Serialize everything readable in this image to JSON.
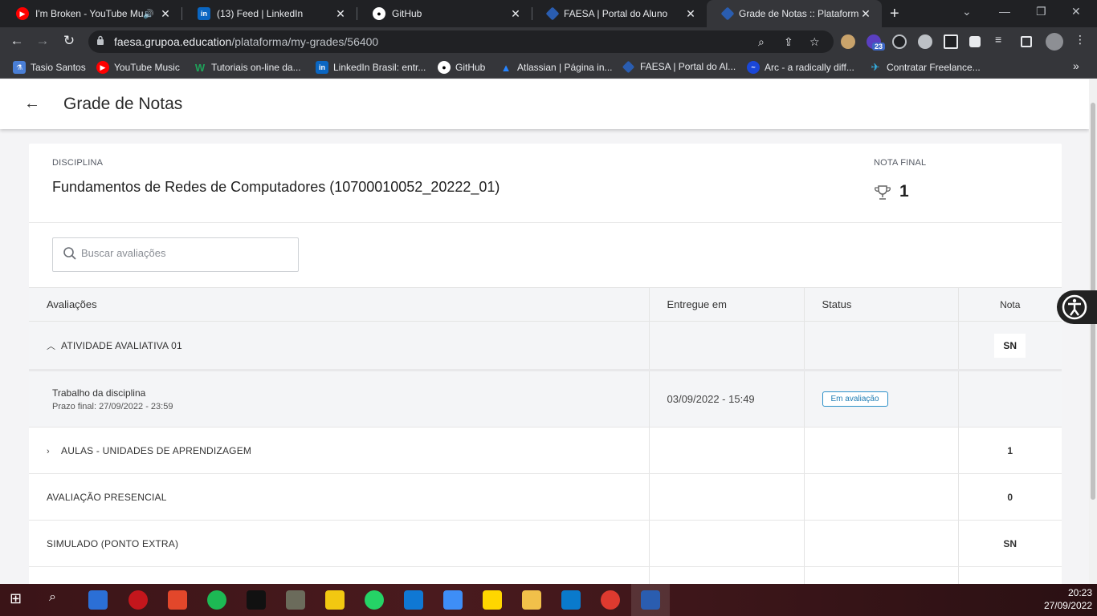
{
  "browser": {
    "tabs": [
      {
        "title": "I'm Broken - YouTube Mu",
        "favicon": "youtube-music",
        "color": "#ff0000",
        "audio": true
      },
      {
        "title": "(13) Feed | LinkedIn",
        "favicon": "linkedin",
        "color": "#0a66c2"
      },
      {
        "title": "GitHub",
        "favicon": "github",
        "color": "#ffffff"
      },
      {
        "title": "FAESA | Portal do Aluno",
        "favicon": "faesa",
        "color": "#2a5db0"
      },
      {
        "title": "Grade de Notas :: Plataforma",
        "favicon": "faesa",
        "color": "#2a5db0",
        "active": true
      }
    ],
    "url_host": "faesa.grupoa.education",
    "url_path": "/plataforma/my-grades/56400",
    "extension_badge": "23",
    "bookmarks": [
      {
        "label": "Tasio Santos",
        "icon": "flask"
      },
      {
        "label": "YouTube Music",
        "icon": "youtube-music"
      },
      {
        "label": "Tutoriais on-line da...",
        "icon": "w"
      },
      {
        "label": "LinkedIn Brasil: entr...",
        "icon": "linkedin"
      },
      {
        "label": "GitHub",
        "icon": "github"
      },
      {
        "label": "Atlassian | Página in...",
        "icon": "atlassian"
      },
      {
        "label": "FAESA | Portal do Al...",
        "icon": "faesa"
      },
      {
        "label": "Arc - a radically diff...",
        "icon": "arc"
      },
      {
        "label": "Contratar Freelance...",
        "icon": "workana"
      }
    ]
  },
  "header": {
    "title": "Grade de Notas"
  },
  "discipline": {
    "label": "DISCIPLINA",
    "name": "Fundamentos de Redes de Computadores (10700010052_20222_01)",
    "final_label": "NOTA FINAL",
    "final_value": "1"
  },
  "search": {
    "placeholder": "Buscar avaliações"
  },
  "table": {
    "headers": {
      "name": "Avaliações",
      "date": "Entregue em",
      "status": "Status",
      "note": "Nota"
    },
    "group1": {
      "name": "ATIVIDADE AVALIATIVA 01",
      "note": "SN"
    },
    "sub1": {
      "title": "Trabalho da disciplina",
      "deadline": "Prazo final: 27/09/2022 - 23:59",
      "delivered": "03/09/2022 - 15:49",
      "status": "Em avaliação"
    },
    "group2": {
      "name": "AULAS - UNIDADES DE APRENDIZAGEM",
      "note": "1"
    },
    "row3": {
      "name": "AVALIAÇÃO PRESENCIAL",
      "note": "0"
    },
    "row4": {
      "name": "SIMULADO (PONTO EXTRA)",
      "note": "SN"
    }
  },
  "taskbar": {
    "time": "20:23",
    "date": "27/09/2022"
  },
  "colors": {
    "status_border": "#2b90c8",
    "chrome_dark": "#202124"
  }
}
